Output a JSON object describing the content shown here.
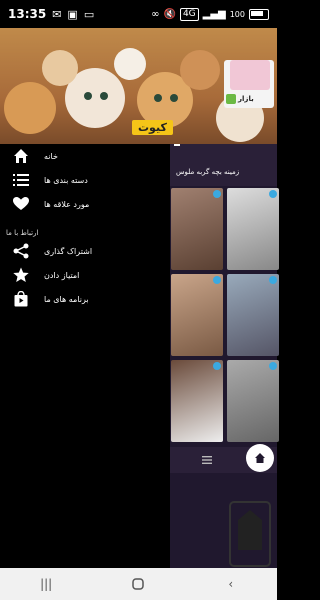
{
  "status": {
    "time": "13:35",
    "battery": "100"
  },
  "banner": {
    "title": "کیوت",
    "ad_app_name": "بازار"
  },
  "drawer": {
    "items": [
      {
        "label": "خانه",
        "icon": "home-icon"
      },
      {
        "label": "دسته بندی ها",
        "icon": "list-icon"
      },
      {
        "label": "مورد علاقه ها",
        "icon": "heart-icon"
      }
    ],
    "section_title": "ارتباط با ما",
    "contact_items": [
      {
        "label": "اشتراک گذاری",
        "icon": "share-icon"
      },
      {
        "label": "امتیاز دادن",
        "icon": "star-icon"
      },
      {
        "label": "برنامه های ما",
        "icon": "bag-icon"
      }
    ]
  },
  "main": {
    "toolbar_title": "زمینه بچه گربه ملوس"
  },
  "colors": {
    "accent": "#3ba9e0",
    "background": "#20182e",
    "drawer": "#000000"
  }
}
